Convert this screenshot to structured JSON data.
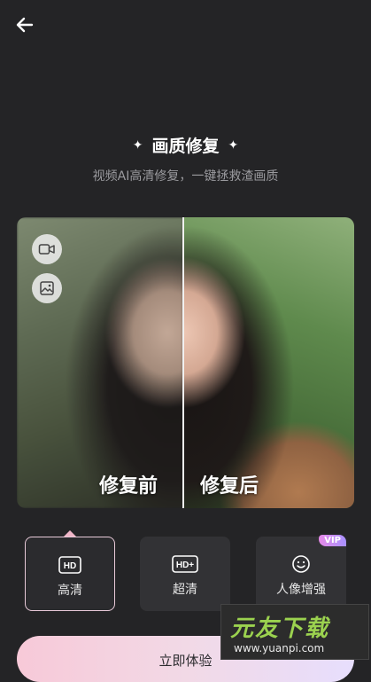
{
  "header": {
    "back_icon": "arrow-left-icon"
  },
  "hero": {
    "title": "画质修复",
    "subtitle": "视频AI高清修复，一键拯救渣画质"
  },
  "compare": {
    "before_label": "修复前",
    "after_label": "修复后",
    "mode_icons": [
      "video-camera-icon",
      "image-icon"
    ]
  },
  "options": [
    {
      "icon": "HD",
      "label": "高清",
      "selected": true
    },
    {
      "icon": "HD+",
      "label": "超清",
      "selected": false
    },
    {
      "icon": "face-smile-icon",
      "label": "人像增强",
      "selected": false,
      "badge": "VIP"
    }
  ],
  "cta": {
    "label": "立即体验"
  },
  "watermark": {
    "title": "元友下载",
    "url": "www.yuanpi.com"
  },
  "colors": {
    "background": "#242426",
    "cta_gradient_start": "#f7c9d8",
    "cta_gradient_end": "#e7defd",
    "vip_badge": "#e78ae8"
  }
}
